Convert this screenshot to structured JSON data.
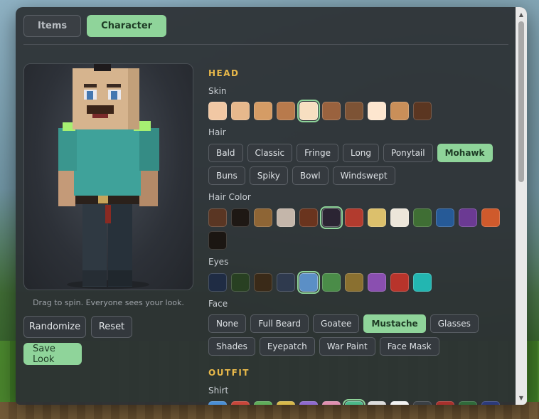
{
  "tabs": [
    {
      "label": "Items",
      "active": false
    },
    {
      "label": "Character",
      "active": true
    }
  ],
  "preview": {
    "hint": "Drag to spin. Everyone sees your look."
  },
  "actions": {
    "randomize_label": "Randomize",
    "reset_label": "Reset",
    "save_label": "Save Look"
  },
  "sections": {
    "head_title": "HEAD",
    "outfit_title": "OUTFIT"
  },
  "skin": {
    "label": "Skin",
    "colors": [
      "#f1c8a4",
      "#e6b88c",
      "#d59c65",
      "#b87a4c",
      "#f7dfc1",
      "#9a623e",
      "#7d5335",
      "#fde6cf",
      "#c98f59",
      "#5b3621"
    ],
    "selected_index": 4
  },
  "hair": {
    "label": "Hair",
    "options": [
      "Bald",
      "Classic",
      "Fringe",
      "Long",
      "Ponytail",
      "Mohawk",
      "Buns",
      "Spiky",
      "Bowl",
      "Windswept"
    ],
    "selected_index": 5
  },
  "hair_color": {
    "label": "Hair Color",
    "colors": [
      "#5a3623",
      "#1e1814",
      "#8e6535",
      "#c4b6aa",
      "#6a341e",
      "#2b2433",
      "#b23b2e",
      "#dcc06c",
      "#ece6da",
      "#3f6e34",
      "#265a97",
      "#6b3a93",
      "#cf5a2c",
      "#1b1612"
    ],
    "selected_index": 5
  },
  "eyes": {
    "label": "Eyes",
    "colors": [
      "#1f2c44",
      "#284022",
      "#3a2a18",
      "#2f3a4e",
      "#5b8fc6",
      "#4a8c48",
      "#8a7030",
      "#8a4fb0",
      "#b8342b",
      "#23b6b1"
    ],
    "selected_index": 4
  },
  "face": {
    "label": "Face",
    "options": [
      "None",
      "Full Beard",
      "Goatee",
      "Mustache",
      "Glasses",
      "Shades",
      "Eyepatch",
      "War Paint",
      "Face Mask"
    ],
    "selected_index": 3
  },
  "shirt": {
    "label": "Shirt",
    "colors": [
      "#4a8fd6",
      "#c9463a",
      "#5fae5a",
      "#d8b94a",
      "#8f6ad0",
      "#e08fb0",
      "#4bb889",
      "#dcdcdc",
      "#f2f2f2",
      "#3a3f44",
      "#a8302c",
      "#2f6a3a",
      "#2b3a7a"
    ],
    "selected_index": 6
  }
}
